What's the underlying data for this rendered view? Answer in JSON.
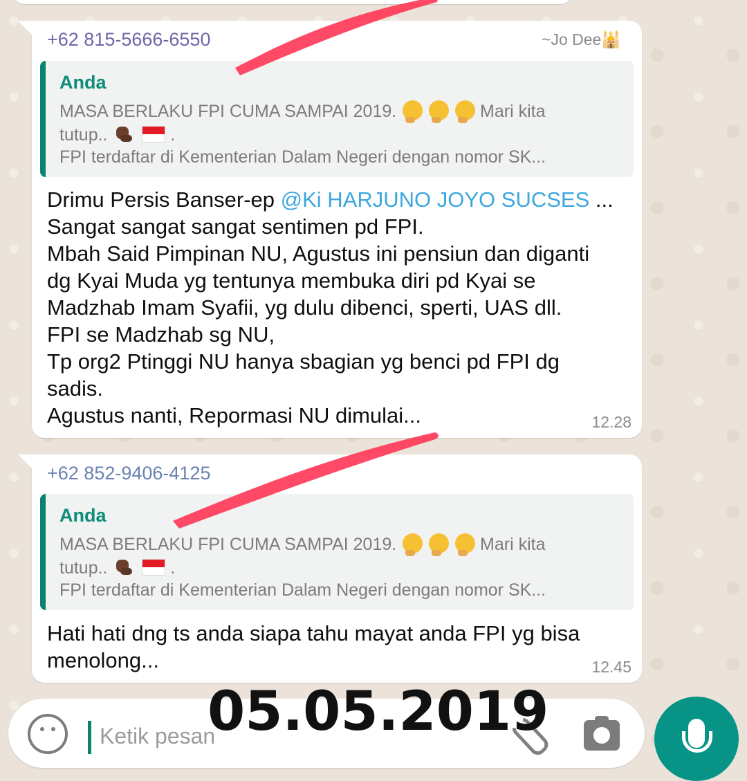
{
  "chat": {
    "message_1": {
      "sender_number": "+62 815-5666-6550",
      "sender_pushname": "~Jo Dee🕌",
      "quote": {
        "author": "Anda",
        "line_1": "MASA BERLAKU FPI CUMA SAMPAI 2019.",
        "line_1_suffix": "Mari kita",
        "line_2": "tutup..",
        "line_2_suffix": ".",
        "line_3": "FPI terdaftar di Kementerian Dalam Negeri dengan nomor SK..."
      },
      "text": {
        "line_1_before_mention": "Drimu Persis Banser-ep ",
        "mention": "@Ki HARJUNO JOYO SUCSES",
        "line_1_after_mention": " ...",
        "line_2": "Sangat sangat sangat sentimen pd FPI.",
        "line_3": "Mbah Said Pimpinan NU, Agustus ini pensiun dan diganti",
        "line_4": "dg Kyai Muda yg tentunya membuka diri pd Kyai se",
        "line_5": "Madzhab Imam Syafii, yg dulu dibenci, sperti, UAS dll.",
        "line_6": "FPI se Madzhab sg NU,",
        "line_7": "Tp org2 Ptinggi NU hanya sbagian yg benci pd FPI dg",
        "line_8": "sadis.",
        "line_9": "Agustus nanti, Repormasi NU dimulai..."
      },
      "time": "12.28"
    },
    "message_2": {
      "sender_number": "+62 852-9406-4125",
      "quote": {
        "author": "Anda",
        "line_1": "MASA BERLAKU FPI CUMA SAMPAI 2019.",
        "line_1_suffix": "Mari kita",
        "line_2": "tutup..",
        "line_2_suffix": ".",
        "line_3": "FPI terdaftar di Kementerian Dalam Negeri dengan nomor SK..."
      },
      "text": {
        "line_1": "Hati hati dng ts anda siapa tahu mayat anda FPI yg bisa",
        "line_2": "menolong..."
      },
      "time": "12.45"
    }
  },
  "composer": {
    "placeholder": "Ketik pesan"
  },
  "overlay": {
    "date": "05.05.2019"
  },
  "icons": {
    "emoji_button": "smiley-icon",
    "attach": "paperclip-icon",
    "camera": "camera-icon",
    "send_voice": "microphone-icon",
    "quoted_emojis": [
      "thinking-face-icon",
      "flexed-biceps-icon",
      "indonesia-flag-icon"
    ]
  },
  "colors": {
    "wallpaper": "#ebe3d9",
    "accent": "#079487",
    "quote_author": "#0f8d79",
    "sender_1": "#7364a8",
    "sender_2": "#6b82b1",
    "mention": "#3ba7df",
    "highlight_stroke": "#ff3152"
  }
}
